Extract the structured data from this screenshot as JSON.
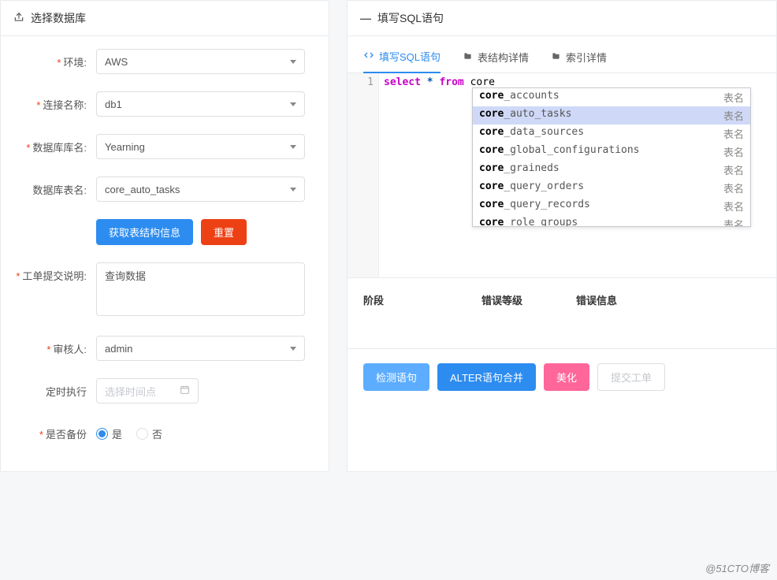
{
  "left": {
    "title": "选择数据库",
    "fields": {
      "env": {
        "label": "环境:",
        "value": "AWS",
        "required": true
      },
      "conn": {
        "label": "连接名称:",
        "value": "db1",
        "required": true
      },
      "db": {
        "label": "数据库库名:",
        "value": "Yearning",
        "required": true
      },
      "table": {
        "label": "数据库表名:",
        "value": "core_auto_tasks",
        "required": false
      },
      "desc": {
        "label": "工单提交说明:",
        "value": "查询数据",
        "required": true
      },
      "approver": {
        "label": "审核人:",
        "value": "admin",
        "required": true
      },
      "schedule": {
        "label": "定时执行",
        "placeholder": "选择时间点",
        "required": false
      },
      "backup": {
        "label": "是否备份",
        "required": true,
        "options": {
          "yes": "是",
          "no": "否"
        },
        "value": "yes"
      }
    },
    "buttons": {
      "fetch": "获取表结构信息",
      "reset": "重置"
    }
  },
  "right": {
    "title": "填写SQL语句",
    "tabs": [
      {
        "label": "填写SQL语句",
        "active": true,
        "icon": "code"
      },
      {
        "label": "表结构详情",
        "active": false,
        "icon": "folder"
      },
      {
        "label": "索引详情",
        "active": false,
        "icon": "folder"
      }
    ],
    "editor": {
      "line_number": "1",
      "tokens": {
        "select": "select",
        "star": "*",
        "from": "from",
        "typed": "core"
      },
      "autocomplete": {
        "kind_label": "表名",
        "prefix": "core",
        "selected_index": 1,
        "items": [
          "core_accounts",
          "core_auto_tasks",
          "core_data_sources",
          "core_global_configurations",
          "core_graineds",
          "core_query_orders",
          "core_query_records",
          "core_role_groups"
        ]
      }
    },
    "result_header": {
      "stage": "阶段",
      "level": "错误等级",
      "info": "错误信息"
    },
    "actions": {
      "check": "检测语句",
      "alter": "ALTER语句合并",
      "beautify": "美化",
      "submit": "提交工单"
    }
  },
  "watermark": "@51CTO博客"
}
